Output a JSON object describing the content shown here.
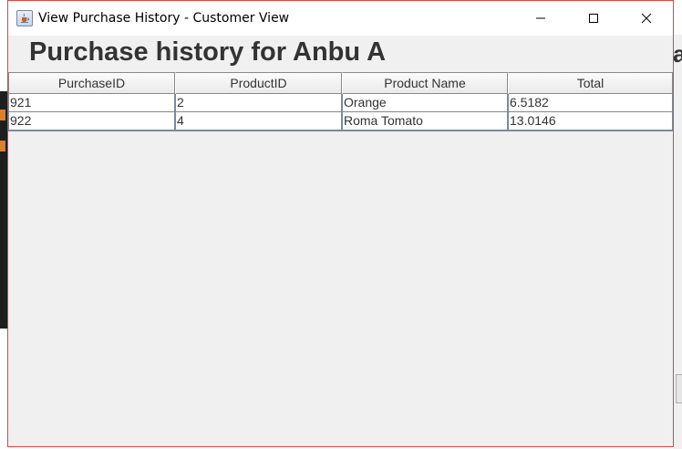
{
  "window": {
    "title": "View Purchase History - Customer View"
  },
  "heading": "Purchase history for Anbu A",
  "background_glyph": "a",
  "table": {
    "columns": [
      "PurchaseID",
      "ProductID",
      "Product Name",
      "Total"
    ],
    "rows": [
      [
        "921",
        "2",
        "Orange",
        "6.5182"
      ],
      [
        "922",
        "4",
        "Roma Tomato",
        "13.0146"
      ]
    ]
  },
  "icons": {
    "app": "java-cup-icon",
    "minimize": "minimize-icon",
    "maximize": "maximize-icon",
    "close": "close-icon"
  },
  "colors": {
    "window_border": "#e04343",
    "content_bg": "#f0f0f0",
    "heading": "#333333"
  }
}
